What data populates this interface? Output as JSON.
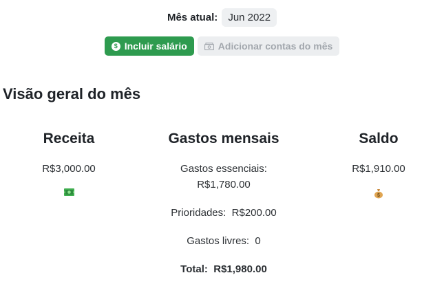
{
  "header": {
    "month_label": "Mês atual:",
    "month_value": "Jun 2022",
    "include_salary_label": "Incluir salário",
    "add_bills_label": "Adicionar contas do mês"
  },
  "overview": {
    "title": "Visão geral do mês",
    "income": {
      "heading": "Receita",
      "value": "R$3,000.00",
      "icon": "money-banknote-icon"
    },
    "expenses": {
      "heading": "Gastos mensais",
      "essentials_label": "Gastos essenciais:",
      "essentials_value": "R$1,780.00",
      "priorities_label": "Prioridades:",
      "priorities_value": "R$200.00",
      "free_label": "Gastos livres:",
      "free_value": "0",
      "total_label": "Total:",
      "total_value": "R$1,980.00"
    },
    "balance": {
      "heading": "Saldo",
      "value": "R$1,910.00",
      "icon": "money-bag-icon"
    }
  },
  "colors": {
    "accent_green": "#2e9b4f",
    "disabled_gray": "#eceef0"
  }
}
